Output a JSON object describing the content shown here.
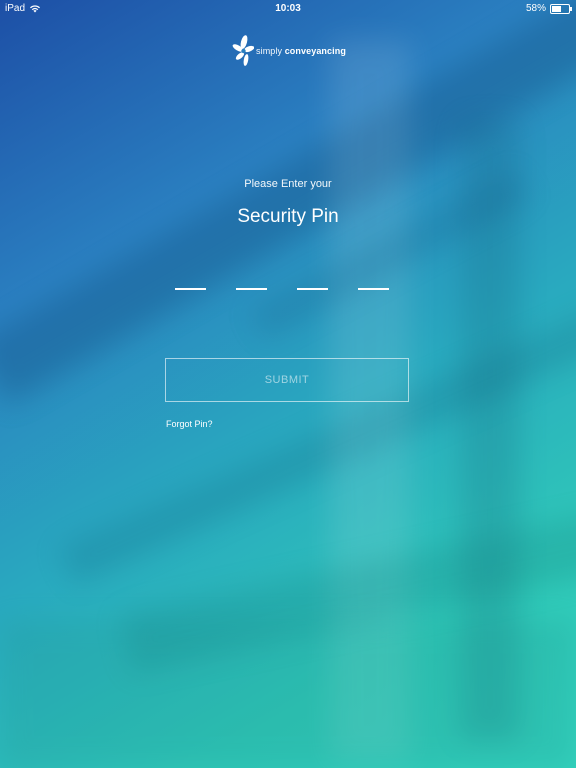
{
  "status_bar": {
    "device": "iPad",
    "time": "10:03",
    "battery_text": "58%",
    "battery_level": 0.58,
    "wifi_icon": "wifi-icon",
    "battery_icon": "battery-icon"
  },
  "logo": {
    "icon": "flower-logo-icon",
    "text_light": "simply ",
    "text_bold": "conveyancing"
  },
  "pin_screen": {
    "prompt": "Please Enter your",
    "title": "Security Pin",
    "pin_slots": [
      "",
      "",
      "",
      ""
    ],
    "submit_label": "SUBMIT",
    "forgot_label": "Forgot Pin?"
  },
  "colors": {
    "gradient_start": "#1d4fa6",
    "gradient_end": "#33d2bd",
    "text": "#ffffff"
  }
}
